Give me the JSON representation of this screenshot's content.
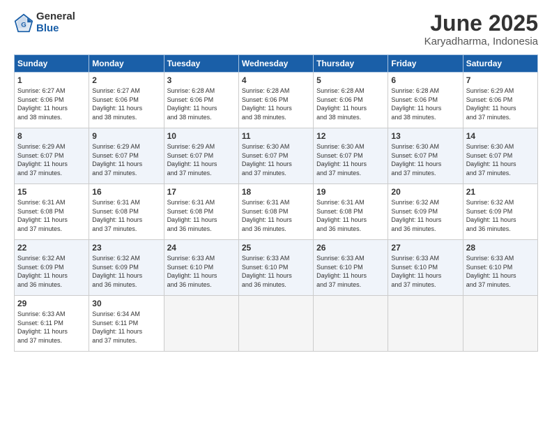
{
  "logo": {
    "general": "General",
    "blue": "Blue"
  },
  "header": {
    "title": "June 2025",
    "subtitle": "Karyadharma, Indonesia"
  },
  "days_of_week": [
    "Sunday",
    "Monday",
    "Tuesday",
    "Wednesday",
    "Thursday",
    "Friday",
    "Saturday"
  ],
  "weeks": [
    [
      {
        "day": "1",
        "info": "Sunrise: 6:27 AM\nSunset: 6:06 PM\nDaylight: 11 hours\nand 38 minutes."
      },
      {
        "day": "2",
        "info": "Sunrise: 6:27 AM\nSunset: 6:06 PM\nDaylight: 11 hours\nand 38 minutes."
      },
      {
        "day": "3",
        "info": "Sunrise: 6:28 AM\nSunset: 6:06 PM\nDaylight: 11 hours\nand 38 minutes."
      },
      {
        "day": "4",
        "info": "Sunrise: 6:28 AM\nSunset: 6:06 PM\nDaylight: 11 hours\nand 38 minutes."
      },
      {
        "day": "5",
        "info": "Sunrise: 6:28 AM\nSunset: 6:06 PM\nDaylight: 11 hours\nand 38 minutes."
      },
      {
        "day": "6",
        "info": "Sunrise: 6:28 AM\nSunset: 6:06 PM\nDaylight: 11 hours\nand 38 minutes."
      },
      {
        "day": "7",
        "info": "Sunrise: 6:29 AM\nSunset: 6:06 PM\nDaylight: 11 hours\nand 37 minutes."
      }
    ],
    [
      {
        "day": "8",
        "info": "Sunrise: 6:29 AM\nSunset: 6:07 PM\nDaylight: 11 hours\nand 37 minutes."
      },
      {
        "day": "9",
        "info": "Sunrise: 6:29 AM\nSunset: 6:07 PM\nDaylight: 11 hours\nand 37 minutes."
      },
      {
        "day": "10",
        "info": "Sunrise: 6:29 AM\nSunset: 6:07 PM\nDaylight: 11 hours\nand 37 minutes."
      },
      {
        "day": "11",
        "info": "Sunrise: 6:30 AM\nSunset: 6:07 PM\nDaylight: 11 hours\nand 37 minutes."
      },
      {
        "day": "12",
        "info": "Sunrise: 6:30 AM\nSunset: 6:07 PM\nDaylight: 11 hours\nand 37 minutes."
      },
      {
        "day": "13",
        "info": "Sunrise: 6:30 AM\nSunset: 6:07 PM\nDaylight: 11 hours\nand 37 minutes."
      },
      {
        "day": "14",
        "info": "Sunrise: 6:30 AM\nSunset: 6:07 PM\nDaylight: 11 hours\nand 37 minutes."
      }
    ],
    [
      {
        "day": "15",
        "info": "Sunrise: 6:31 AM\nSunset: 6:08 PM\nDaylight: 11 hours\nand 37 minutes."
      },
      {
        "day": "16",
        "info": "Sunrise: 6:31 AM\nSunset: 6:08 PM\nDaylight: 11 hours\nand 37 minutes."
      },
      {
        "day": "17",
        "info": "Sunrise: 6:31 AM\nSunset: 6:08 PM\nDaylight: 11 hours\nand 36 minutes."
      },
      {
        "day": "18",
        "info": "Sunrise: 6:31 AM\nSunset: 6:08 PM\nDaylight: 11 hours\nand 36 minutes."
      },
      {
        "day": "19",
        "info": "Sunrise: 6:31 AM\nSunset: 6:08 PM\nDaylight: 11 hours\nand 36 minutes."
      },
      {
        "day": "20",
        "info": "Sunrise: 6:32 AM\nSunset: 6:09 PM\nDaylight: 11 hours\nand 36 minutes."
      },
      {
        "day": "21",
        "info": "Sunrise: 6:32 AM\nSunset: 6:09 PM\nDaylight: 11 hours\nand 36 minutes."
      }
    ],
    [
      {
        "day": "22",
        "info": "Sunrise: 6:32 AM\nSunset: 6:09 PM\nDaylight: 11 hours\nand 36 minutes."
      },
      {
        "day": "23",
        "info": "Sunrise: 6:32 AM\nSunset: 6:09 PM\nDaylight: 11 hours\nand 36 minutes."
      },
      {
        "day": "24",
        "info": "Sunrise: 6:33 AM\nSunset: 6:10 PM\nDaylight: 11 hours\nand 36 minutes."
      },
      {
        "day": "25",
        "info": "Sunrise: 6:33 AM\nSunset: 6:10 PM\nDaylight: 11 hours\nand 36 minutes."
      },
      {
        "day": "26",
        "info": "Sunrise: 6:33 AM\nSunset: 6:10 PM\nDaylight: 11 hours\nand 37 minutes."
      },
      {
        "day": "27",
        "info": "Sunrise: 6:33 AM\nSunset: 6:10 PM\nDaylight: 11 hours\nand 37 minutes."
      },
      {
        "day": "28",
        "info": "Sunrise: 6:33 AM\nSunset: 6:10 PM\nDaylight: 11 hours\nand 37 minutes."
      }
    ],
    [
      {
        "day": "29",
        "info": "Sunrise: 6:33 AM\nSunset: 6:11 PM\nDaylight: 11 hours\nand 37 minutes."
      },
      {
        "day": "30",
        "info": "Sunrise: 6:34 AM\nSunset: 6:11 PM\nDaylight: 11 hours\nand 37 minutes."
      },
      {
        "day": "",
        "info": ""
      },
      {
        "day": "",
        "info": ""
      },
      {
        "day": "",
        "info": ""
      },
      {
        "day": "",
        "info": ""
      },
      {
        "day": "",
        "info": ""
      }
    ]
  ]
}
